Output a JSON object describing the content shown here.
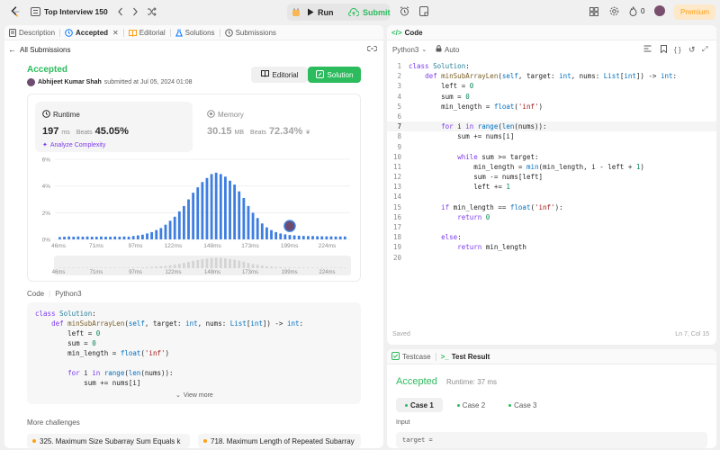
{
  "topbar": {
    "list_title": "Top Interview 150",
    "run_label": "Run",
    "submit_label": "Submit",
    "fire_count": "0",
    "premium_label": "Premium"
  },
  "left_tabs": [
    {
      "label": "Description",
      "icon": "description-icon"
    },
    {
      "label": "Accepted",
      "icon": "history-icon"
    },
    {
      "label": "Editorial",
      "icon": "book-icon"
    },
    {
      "label": "Solutions",
      "icon": "flask-icon"
    },
    {
      "label": "Submissions",
      "icon": "history-icon"
    }
  ],
  "submission": {
    "back_label": "All Submissions",
    "status": "Accepted",
    "author": "Abhijeet Kumar Shah",
    "submitted_text": "submitted at Jul 05, 2024 01:08",
    "editorial_btn": "Editorial",
    "solution_btn": "Solution"
  },
  "stats": {
    "runtime_label": "Runtime",
    "runtime_value": "197",
    "runtime_unit": "ms",
    "runtime_beats_label": "Beats",
    "runtime_beats": "45.05%",
    "analyze_label": "Analyze Complexity",
    "memory_label": "Memory",
    "memory_value": "30.15",
    "memory_unit": "MB",
    "memory_beats_label": "Beats",
    "memory_beats": "72.34%"
  },
  "chart_data": {
    "type": "bar",
    "ylabel_ticks": [
      "6%",
      "4%",
      "2%",
      "0%"
    ],
    "ylim": [
      0,
      6
    ],
    "x_tick_labels": [
      "46ms",
      "71ms",
      "97ms",
      "122ms",
      "148ms",
      "173ms",
      "199ms",
      "224ms"
    ],
    "xlim_ms": [
      46,
      238
    ],
    "values": [
      0.18,
      0.2,
      0.22,
      0.2,
      0.22,
      0.2,
      0.22,
      0.2,
      0.2,
      0.22,
      0.2,
      0.2,
      0.22,
      0.2,
      0.22,
      0.2,
      0.25,
      0.3,
      0.35,
      0.45,
      0.55,
      0.7,
      0.85,
      1.1,
      1.4,
      1.7,
      2.1,
      2.5,
      3.0,
      3.5,
      3.9,
      4.3,
      4.6,
      4.9,
      5.0,
      4.9,
      4.7,
      4.4,
      4.1,
      3.6,
      3.1,
      2.5,
      2.0,
      1.6,
      1.2,
      0.9,
      0.7,
      0.55,
      0.45,
      0.38,
      0.33,
      0.3,
      0.28,
      0.26,
      0.25,
      0.25,
      0.24,
      0.24,
      0.23,
      0.23,
      0.22,
      0.22,
      0.22
    ],
    "highlight_ms": 197,
    "overview_ticks": [
      "46ms",
      "71ms",
      "97ms",
      "122ms",
      "148ms",
      "173ms",
      "199ms",
      "224ms"
    ]
  },
  "code_section": {
    "label": "Code",
    "lang": "Python3",
    "view_more": "View more",
    "preview_lines": [
      "class Solution:",
      "    def minSubArrayLen(self, target: int, nums: List[int]) -> int:",
      "        left = 0",
      "        sum = 0",
      "        min_length = float('inf')",
      "",
      "        for i in range(len(nums)):",
      "            sum += nums[i]"
    ]
  },
  "more_challenges": {
    "title": "More challenges",
    "items": [
      "325. Maximum Size Subarray Sum Equals k",
      "718. Maximum Length of Repeated Subarray"
    ]
  },
  "editor": {
    "tab_label": "Code",
    "language": "Python3",
    "auto_label": "Auto",
    "saved_label": "Saved",
    "cursor_pos": "Ln 7, Col 15",
    "current_line": 7,
    "lines": [
      "class Solution:",
      "    def minSubArrayLen(self, target: int, nums: List[int]) -> int:",
      "        left = 0",
      "        sum = 0",
      "        min_length = float('inf')",
      "",
      "        for i in range(len(nums)):",
      "            sum += nums[i]",
      "",
      "            while sum >= target:",
      "                min_length = min(min_length, i - left + 1)",
      "                sum -= nums[left]",
      "                left += 1",
      "",
      "        if min_length == float('inf'):",
      "            return 0",
      "",
      "        else:",
      "            return min_length",
      ""
    ]
  },
  "result": {
    "testcase_tab": "Testcase",
    "result_tab": "Test Result",
    "status": "Accepted",
    "runtime": "Runtime: 37 ms",
    "cases": [
      "Case 1",
      "Case 2",
      "Case 3"
    ],
    "input_label": "Input",
    "input_value": "target ="
  },
  "colors": {
    "accent_green": "#2cbb5d",
    "accent_orange": "#ffa116",
    "bar_blue": "#3d7ee0",
    "highlight_purple": "#7c3aed"
  }
}
